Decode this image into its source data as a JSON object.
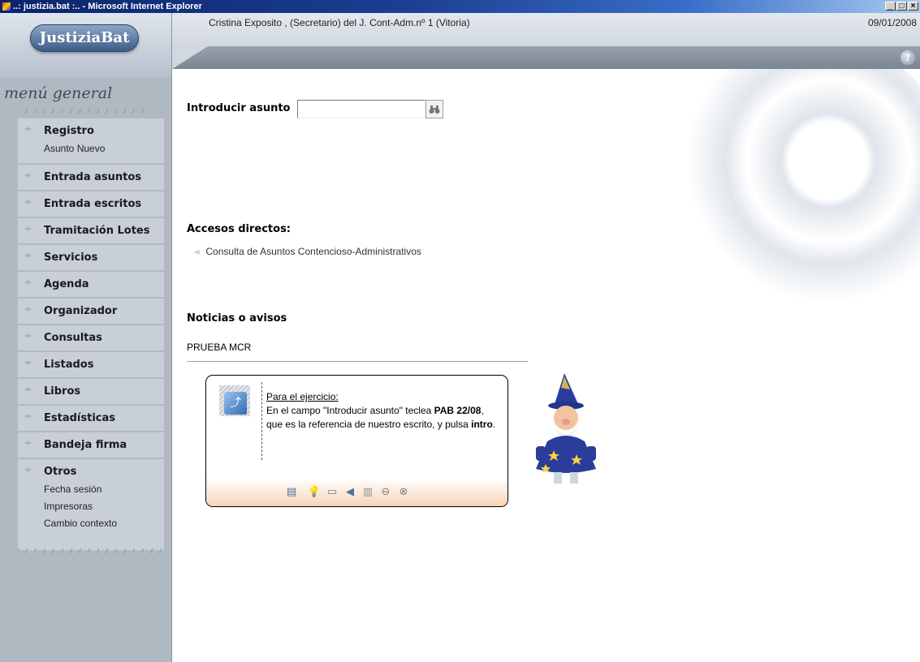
{
  "window": {
    "title": "..: justizia.bat :.. - Microsoft Internet Explorer",
    "controls": [
      "_",
      "□",
      "×"
    ]
  },
  "header": {
    "logo_text": "JustiziaBat",
    "user_info": "Cristina Exposito , (Secretario) del J. Cont-Adm.nº 1 (Vitoria)",
    "date": "09/01/2008",
    "help_icon": "?"
  },
  "sidebar": {
    "title": "menú general",
    "items": [
      {
        "label": "Registro",
        "subitems": [
          "Asunto Nuevo"
        ]
      },
      {
        "label": "Entrada asuntos",
        "subitems": []
      },
      {
        "label": "Entrada escritos",
        "subitems": []
      },
      {
        "label": "Tramitación Lotes",
        "subitems": []
      },
      {
        "label": "Servicios",
        "subitems": []
      },
      {
        "label": "Agenda",
        "subitems": []
      },
      {
        "label": "Organizador",
        "subitems": []
      },
      {
        "label": "Consultas",
        "subitems": []
      },
      {
        "label": "Listados",
        "subitems": []
      },
      {
        "label": "Libros",
        "subitems": []
      },
      {
        "label": "Estadísticas",
        "subitems": []
      },
      {
        "label": "Bandeja firma",
        "subitems": []
      },
      {
        "label": "Otros",
        "subitems": [
          "Fecha sesión",
          "Impresoras",
          "Cambio contexto"
        ]
      }
    ]
  },
  "main": {
    "asunto_label": "Introducir asunto",
    "asunto_value": "",
    "accesos_title": "Accesos directos:",
    "accesos_links": [
      "Consulta de Asuntos Contencioso-Administrativos"
    ],
    "noticias_title": "Noticias o avisos",
    "noticias": [
      "PRUEBA MCR"
    ]
  },
  "tip": {
    "title": "Para el ejercicio:",
    "text_1": "En el campo \"Introducir asunto\" teclea ",
    "bold_1": "PAB 22/08",
    "text_2": ", que es la referencia de nuestro escrito, y pulsa ",
    "bold_2": "intro",
    "text_3": ".",
    "toolbar_icons": [
      "document-icon",
      "lightbulb-icon",
      "camera-icon",
      "back-icon",
      "pages-icon",
      "minimize-icon",
      "close-icon"
    ]
  },
  "colors": {
    "sidebar_bg": "#b0b8c1",
    "menu_panel": "#c8cfd7",
    "arrow": "#6a8fc5",
    "titlebar": "#0a246a",
    "balloon_toolbar": "#f9d3b5"
  }
}
